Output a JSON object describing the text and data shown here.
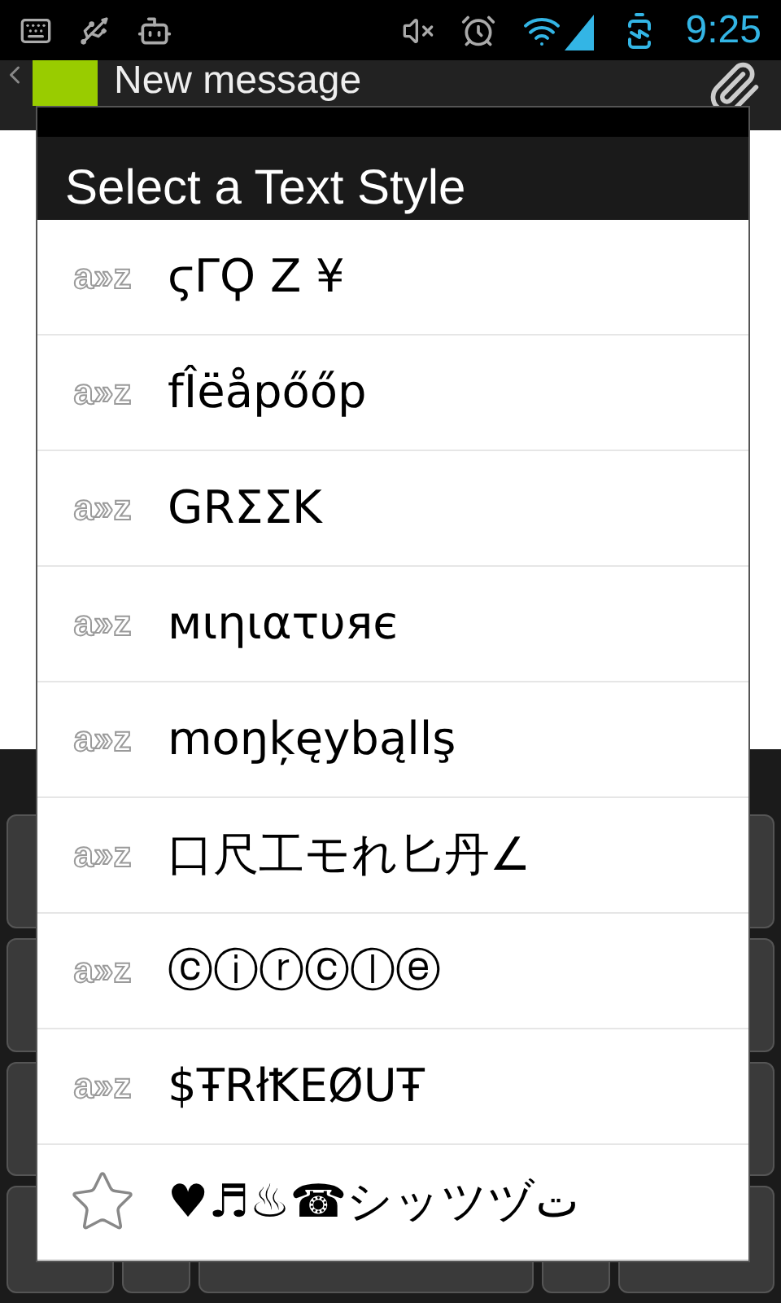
{
  "status_bar": {
    "time": "9:25"
  },
  "action_bar": {
    "title": "New message"
  },
  "dialog": {
    "title": "Select a Text Style",
    "items": [
      {
        "kind": "style",
        "badge": "a»z",
        "label": "ϛΓϘ Ζ ¥"
      },
      {
        "kind": "style",
        "badge": "a»z",
        "label": "fÎëåpőőp"
      },
      {
        "kind": "style",
        "badge": "a»z",
        "label": "GRΣΣK"
      },
      {
        "kind": "style",
        "badge": "a»z",
        "label": "мιηιατυяє"
      },
      {
        "kind": "style",
        "badge": "a»z",
        "label": "moŋķęybąllş"
      },
      {
        "kind": "style",
        "badge": "a»z",
        "label": "口尺工モれ匕丹∠"
      },
      {
        "kind": "style",
        "badge": "a»z",
        "label": "ⓒⓘⓡⓒⓛⓔ"
      },
      {
        "kind": "style",
        "badge": "a»z",
        "label": "$ŦRłꝀEØUŦ"
      },
      {
        "kind": "symbols",
        "label": "♥♬♨☎シッツヅت"
      }
    ]
  }
}
